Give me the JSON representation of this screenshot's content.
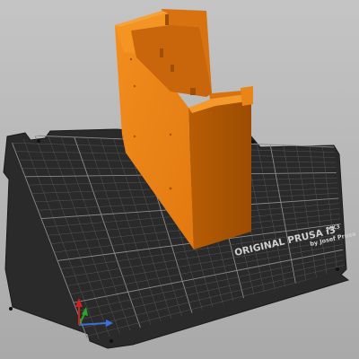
{
  "viewport": {
    "background_color": "#b9b9b9"
  },
  "print_bed": {
    "brand_line_1": "ORIGINAL PRUSA i3",
    "brand_model": "MK3",
    "brand_line_2": "by Josef Prusa",
    "bed_color": "#2c2c2c",
    "grid_color": "#6b6b6b"
  },
  "model": {
    "color": "#e07a10",
    "shade_color": "#b85f06",
    "top_color": "#f08a1c"
  },
  "axes_gizmo": {
    "x_color": "#3a6fe0",
    "y_color": "#2aa52a",
    "z_color": "#d02020"
  }
}
